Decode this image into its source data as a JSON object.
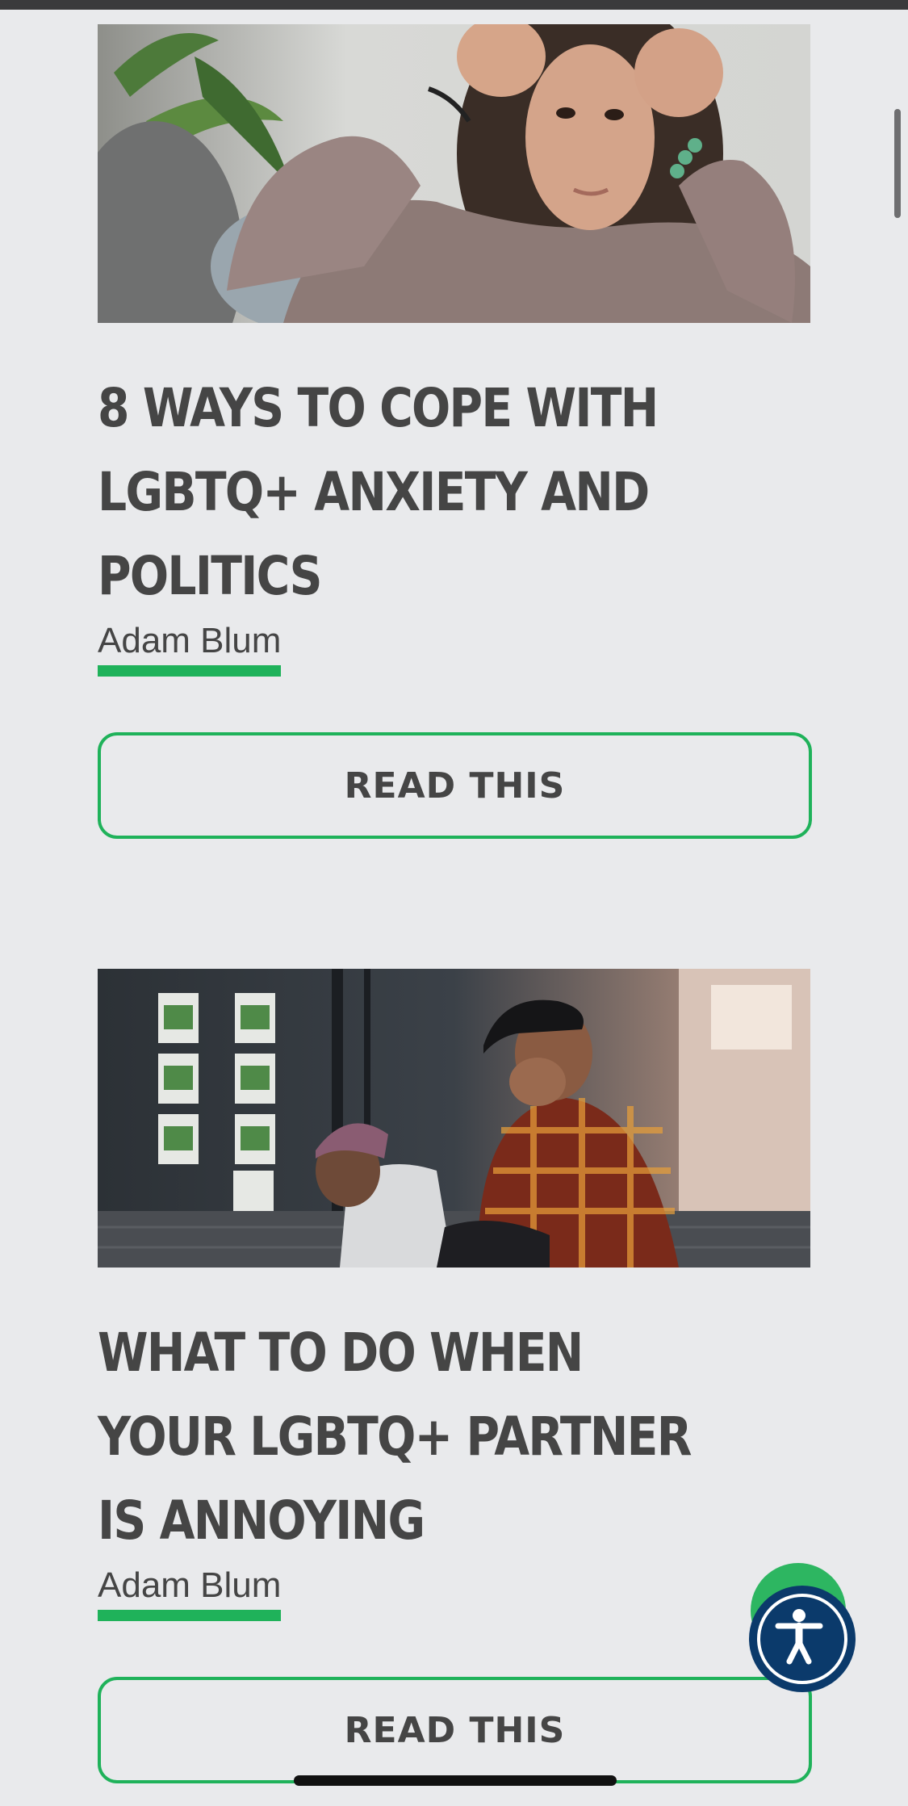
{
  "articles": [
    {
      "title": "8 WAYS TO COPE WITH LGBTQ+ ANXIETY AND POLITICS",
      "author": "Adam Blum",
      "button_label": "READ THIS",
      "image_icon": "photo-stressed-woman"
    },
    {
      "title": "WHAT TO DO WHEN YOUR LGBTQ+ PARTNER IS ANNOYING",
      "author": "Adam Blum",
      "button_label": "READ THIS",
      "image_icon": "photo-two-men-sitting"
    }
  ],
  "accessibility": {
    "icon": "accessibility-icon"
  },
  "colors": {
    "accent_green": "#1fb25a",
    "text": "#454545",
    "background": "#e9eaec",
    "a11y_blue": "#0b3a6b"
  }
}
